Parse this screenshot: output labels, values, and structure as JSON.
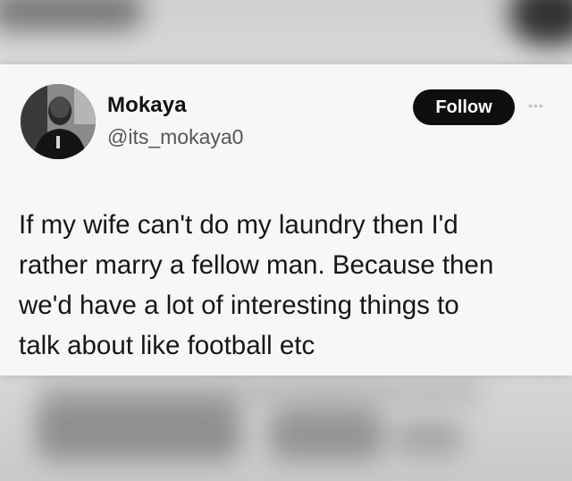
{
  "tweet": {
    "author": {
      "display_name": "Mokaya",
      "handle": "@its_mokaya0",
      "avatar_icon": "profile-photo"
    },
    "follow_label": "Follow",
    "more_icon": "more-dots-icon",
    "text_lines": [
      "If my wife can't do my laundry then I'd",
      "rather marry a fellow man. Because then",
      "we'd have a lot of interesting things to",
      "talk about like football etc"
    ]
  },
  "colors": {
    "follow_button_bg": "#0f0f0f",
    "card_bg": "#f7f7f7",
    "text": "#161616",
    "handle": "#555555"
  }
}
